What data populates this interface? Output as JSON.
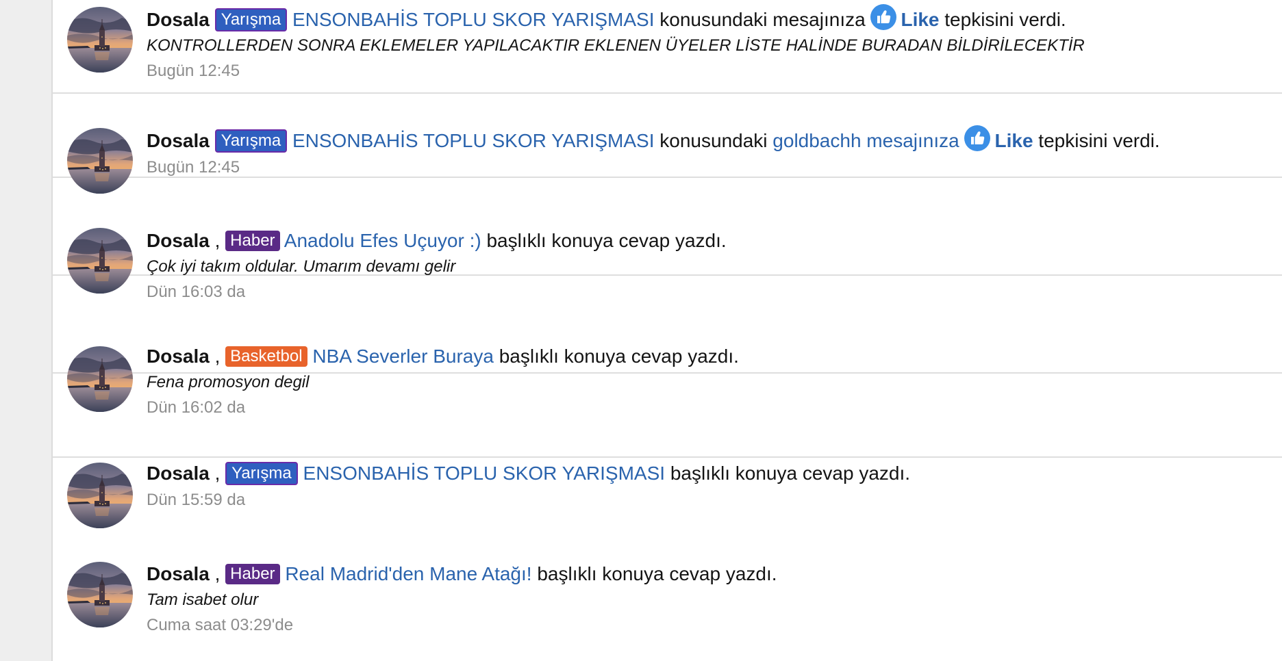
{
  "alerts": [
    {
      "user": "Dosala",
      "prefix": "Yarışma",
      "thread": "ENSONBAHİS TOPLU SKOR YARIŞMASI",
      "text_before": "konusundaki mesajınıza",
      "reaction": "Like",
      "text_after": "tepkisini verdi.",
      "snippet": "KONTROLLERDEN SONRA EKLEMELER YAPILACAKTIR EKLENEN ÜYELER LİSTE HALİNDE BURADAN BİLDİRİLECEKTİR",
      "time": "Bugün 12:45"
    },
    {
      "user": "Dosala",
      "prefix": "Yarışma",
      "thread": "ENSONBAHİS TOPLU SKOR YARIŞMASI",
      "text_before": "konusundaki",
      "post_link": "goldbachh mesajınıza",
      "reaction": "Like",
      "text_after": "tepkisini verdi.",
      "time": "Bugün 12:45"
    },
    {
      "user": "Dosala",
      "separator": ",",
      "prefix": "Haber",
      "thread": "Anadolu Efes Uçuyor :)",
      "text_after": "başlıklı konuya cevap yazdı.",
      "snippet": "Çok iyi takım oldular. Umarım devamı gelir",
      "time": "Dün 16:03 da"
    },
    {
      "user": "Dosala",
      "separator": ",",
      "prefix": "Basketbol",
      "thread": "NBA Severler Buraya",
      "text_after": "başlıklı konuya cevap yazdı.",
      "snippet": "Fena promosyon degil",
      "time": "Dün 16:02 da"
    },
    {
      "user": "Dosala",
      "separator": ",",
      "prefix": "Yarışma",
      "thread": "ENSONBAHİS TOPLU SKOR YARIŞMASI",
      "text_after": "başlıklı konuya cevap yazdı.",
      "time": "Dün 15:59 da"
    },
    {
      "user": "Dosala",
      "separator": ",",
      "prefix": "Haber",
      "thread": "Real Madrid'den Mane Atağı!",
      "text_after": "başlıklı konuya cevap yazdı.",
      "snippet": "Tam isabet olur",
      "time": "Cuma saat 03:29'de"
    }
  ],
  "icons": {
    "like": "thumbs-up-icon",
    "avatar": "maidens-tower-sunset-photo"
  },
  "colors": {
    "link": "#2a63ad",
    "prefix_yarisma": "#2f5fbf",
    "prefix_haber": "#5a2a86",
    "prefix_basketbol": "#e8632b",
    "time": "#8c8c8c",
    "like_icon": "#3b8fe6"
  }
}
